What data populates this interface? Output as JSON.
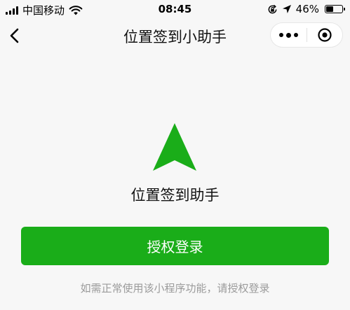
{
  "status_bar": {
    "carrier": "中国移动",
    "time": "08:45",
    "battery_percent": "46%",
    "battery_level": 0.46,
    "icons": [
      "signal-icon",
      "wifi-icon",
      "orientation-lock-icon",
      "location-icon",
      "battery-icon"
    ]
  },
  "nav": {
    "title": "位置签到小助手",
    "icons": [
      "back-icon",
      "more-icon",
      "close-miniprogram-icon"
    ]
  },
  "main": {
    "logo_icon": "navigation-arrow-icon",
    "app_name": "位置签到助手",
    "auth_button_label": "授权登录",
    "hint": "如需正常使用该小程序功能，请授权登录"
  },
  "colors": {
    "brand_green": "#1aad19",
    "background": "#f7f7f7",
    "hint_text": "#9b9b9b"
  }
}
